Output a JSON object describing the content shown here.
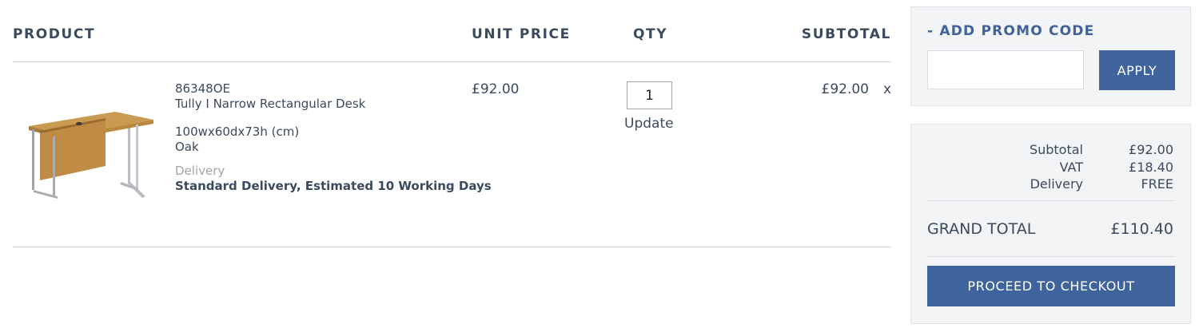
{
  "cart": {
    "columns": {
      "product": "PRODUCT",
      "unit_price": "UNIT PRICE",
      "qty": "QTY",
      "subtotal": "SUBTOTAL"
    },
    "items": [
      {
        "sku": "86348OE",
        "name": "Tully I Narrow Rectangular Desk",
        "dimensions": "100wx60dx73h (cm)",
        "finish": "Oak",
        "delivery_label": "Delivery",
        "delivery_text": "Standard Delivery, Estimated 10 Working Days",
        "unit_price": "£92.00",
        "quantity": "1",
        "update_label": "Update",
        "subtotal": "£92.00",
        "remove_label": "x",
        "image_icon": "desk-product-image"
      }
    ]
  },
  "promo": {
    "toggle_label": "- ADD PROMO CODE",
    "input_value": "",
    "apply_label": "APPLY"
  },
  "totals": {
    "subtotal_label": "Subtotal",
    "subtotal_value": "£92.00",
    "vat_label": "VAT",
    "vat_value": "£18.40",
    "delivery_label": "Delivery",
    "delivery_value": "FREE",
    "grand_total_label": "GRAND TOTAL",
    "grand_total_value": "£110.40",
    "checkout_label": "PROCEED TO CHECKOUT"
  },
  "colors": {
    "accent": "#3f639c",
    "text": "#3b4a5c",
    "muted": "#a0a5ab",
    "panel": "#f3f4f6"
  }
}
